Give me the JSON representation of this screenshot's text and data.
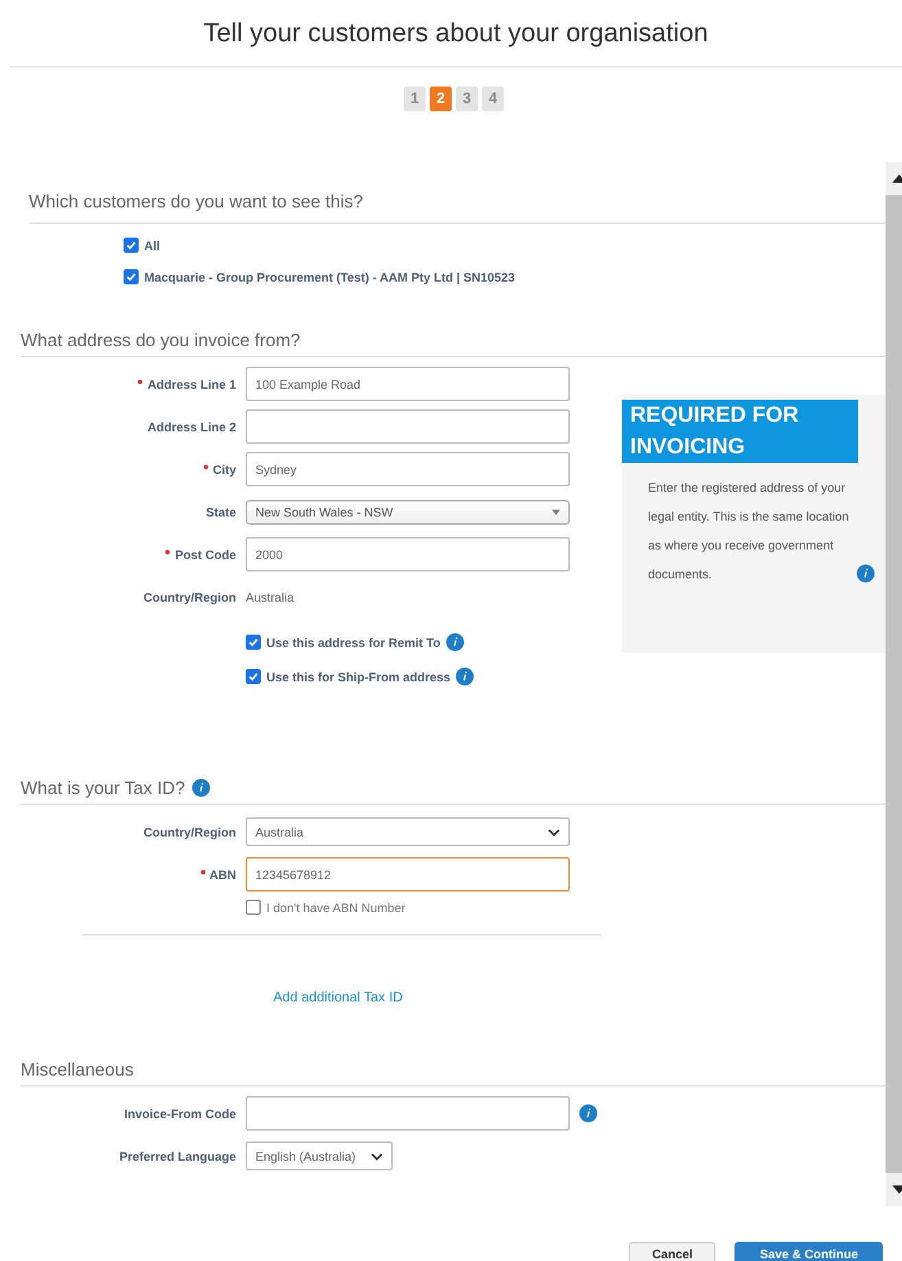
{
  "title": "Tell your customers about your organisation",
  "steps": [
    {
      "label": "1",
      "selected": false
    },
    {
      "label": "2",
      "selected": true
    },
    {
      "label": "3",
      "selected": false
    },
    {
      "label": "4",
      "selected": false
    }
  ],
  "customers": {
    "heading": "Which customers do you want to see this?",
    "options": [
      {
        "label": "All",
        "checked": true
      },
      {
        "label": "Macquarie - Group Procurement (Test) - AAM Pty Ltd |  SN10523",
        "checked": true
      }
    ]
  },
  "address": {
    "heading": "What address do you invoice from?",
    "fields": [
      {
        "kind": "input",
        "label": "Address Line 1",
        "required": true,
        "value": "100 Example Road"
      },
      {
        "kind": "input",
        "label": "Address Line 2",
        "required": false
      },
      {
        "kind": "input",
        "label": "City",
        "required": true,
        "value": "Sydney"
      },
      {
        "kind": "select",
        "label": "State",
        "required": false,
        "value": "New South Wales - NSW"
      },
      {
        "kind": "input",
        "label": "Post Code",
        "required": true,
        "value": "2000"
      },
      {
        "kind": "static",
        "label": "Country/Region",
        "required": false,
        "value": "Australia"
      }
    ],
    "checkboxes": [
      {
        "label": "Use this address for Remit To",
        "checked": true,
        "info": true
      },
      {
        "label": "Use this for Ship-From address",
        "checked": true,
        "info": true
      }
    ],
    "note": {
      "title": "REQUIRED FOR INVOICING",
      "text": "Enter the registered address of your legal entity. This is the same location as where you receive government documents.",
      "info": true
    }
  },
  "tax": {
    "heading": "What is your Tax ID?",
    "info": true,
    "fields": [
      {
        "kind": "dropdown",
        "label": "Country/Region",
        "required": false,
        "value": "Australia"
      },
      {
        "kind": "input",
        "label": "ABN",
        "required": true,
        "value": "12345678912",
        "focused": true
      }
    ],
    "checkboxes": [
      {
        "label": "I don't have ABN Number",
        "checked": false,
        "info": false
      }
    ],
    "link": "Add additional Tax ID"
  },
  "misc": {
    "heading": "Miscellaneous",
    "fields": [
      {
        "kind": "input",
        "label": "Invoice-From Code",
        "required": false,
        "info": true
      },
      {
        "kind": "dropdown",
        "label": "Preferred Language",
        "required": false,
        "value": "English (Australia)",
        "short": true
      }
    ]
  },
  "buttons": [
    {
      "label": "Cancel",
      "kind": "secondary"
    },
    {
      "label": "Save & Continue",
      "kind": "primary"
    }
  ]
}
